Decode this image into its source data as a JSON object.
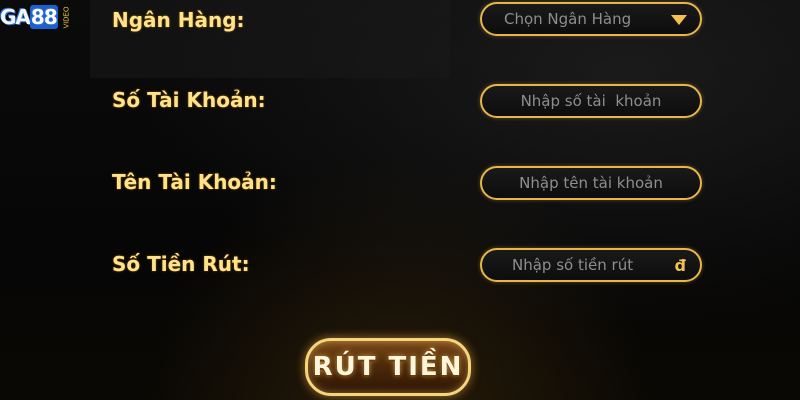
{
  "logo": {
    "text_main": "GA",
    "text_num": "88",
    "sub": "VIDEO"
  },
  "form": {
    "bank": {
      "label": "Ngân Hàng:",
      "placeholder": "Chọn Ngân Hàng"
    },
    "account_number": {
      "label": "Số Tài Khoản:",
      "placeholder": "Nhập số tài  khoản"
    },
    "account_name": {
      "label": "Tên Tài Khoản:",
      "placeholder": "Nhập tên tài khoản"
    },
    "amount": {
      "label": "Số Tiền Rút:",
      "placeholder": "Nhập số tiền rút",
      "currency": "đ"
    }
  },
  "submit_label": "RÚT TIỀN",
  "colors": {
    "accent": "#e8b547",
    "label": "#ffe28a",
    "placeholder": "#8e8e8e",
    "background": "#050505"
  }
}
